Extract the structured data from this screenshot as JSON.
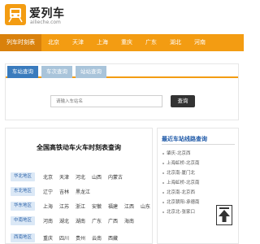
{
  "header": {
    "site_name": "爱列车",
    "domain": "ailieche.com",
    "logo_icon": "train-icon",
    "brand_color": "#f39c12"
  },
  "nav": {
    "items": [
      "列车时刻表",
      "北京",
      "天津",
      "上海",
      "重庆",
      "广东",
      "湖北",
      "河南"
    ],
    "active_index": 0
  },
  "search": {
    "tabs": [
      "车站查询",
      "车次查询",
      "站站查询"
    ],
    "active_tab": 0,
    "input_placeholder": "请输入车站名",
    "button_label": "查询"
  },
  "timetable": {
    "title": "全国高铁动车火车时刻表查询",
    "regions": [
      {
        "name": "华北地区",
        "cities": [
          "北京",
          "天津",
          "河北",
          "山西",
          "内蒙古"
        ]
      },
      {
        "name": "东北地区",
        "cities": [
          "辽宁",
          "吉林",
          "黑龙江"
        ]
      },
      {
        "name": "华东地区",
        "cities": [
          "上海",
          "江苏",
          "浙江",
          "安徽",
          "福建",
          "江西",
          "山东"
        ]
      },
      {
        "name": "中南地区",
        "cities": [
          "河南",
          "湖北",
          "湖南",
          "广东",
          "广西",
          "海南"
        ]
      },
      {
        "name": "西南地区",
        "cities": [
          "重庆",
          "四川",
          "贵州",
          "云南",
          "西藏"
        ]
      }
    ]
  },
  "recent": {
    "title": "最近车站线路查询",
    "routes": [
      "肇庆-北京西",
      "上海虹桥-北京南",
      "北京南-厦门北",
      "上海虹桥-北京南",
      "北京南-北京西",
      "北京朝阳-承德南",
      "北京北-张家口"
    ]
  }
}
